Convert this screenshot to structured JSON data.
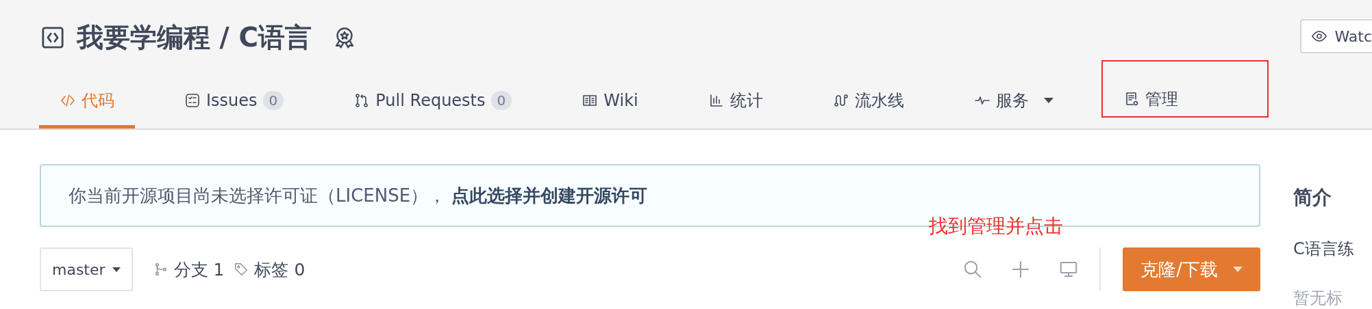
{
  "repo": {
    "title": "我要学编程 / C语言"
  },
  "watch_button": {
    "label": "Watc"
  },
  "tabs": [
    {
      "label": "代码",
      "selected": true,
      "highlighted": false
    },
    {
      "label": "Issues",
      "count": "0",
      "selected": false,
      "highlighted": false
    },
    {
      "label": "Pull Requests",
      "count": "0",
      "selected": false,
      "highlighted": false
    },
    {
      "label": "Wiki",
      "selected": false,
      "highlighted": false
    },
    {
      "label": "统计",
      "selected": false,
      "highlighted": false
    },
    {
      "label": "流水线",
      "selected": false,
      "highlighted": false
    },
    {
      "label": "服务",
      "selected": false,
      "highlighted": false,
      "dropdown": true
    },
    {
      "label": "管理",
      "selected": false,
      "highlighted": true
    }
  ],
  "license_notice": {
    "text": "你当前开源项目尚未选择许可证（LICENSE），",
    "link": "点此选择并创建开源许可"
  },
  "annotation": {
    "text": "找到管理并点击"
  },
  "branch_select": {
    "value": "master"
  },
  "branches": {
    "label": "分支 1"
  },
  "tags": {
    "label": "标签 0"
  },
  "clone_button": {
    "label": "克隆/下载"
  },
  "sidebar": {
    "heading": "简介",
    "description": "C语言练",
    "tags": "暂无标"
  }
}
